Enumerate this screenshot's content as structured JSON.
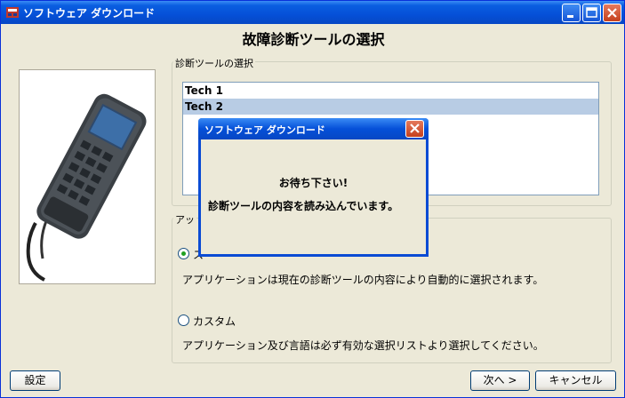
{
  "window": {
    "title": "ソフトウェア ダウンロード"
  },
  "heading": "故障診断ツールの選択",
  "tool_group": {
    "label": "診断ツールの選択",
    "items": [
      {
        "label": "Tech 1",
        "selected": false
      },
      {
        "label": "Tech 2",
        "selected": true
      }
    ]
  },
  "app_group": {
    "label_visible": "アッ",
    "option_standard": {
      "label_visible": "ス",
      "selected": true,
      "description": "アプリケーションは現在の診断ツールの内容により自動的に選択されます。"
    },
    "option_custom": {
      "label": "カスタム",
      "selected": false,
      "description": "アプリケーション及び言語は必ず有効な選択リストより選択してください。"
    }
  },
  "buttons": {
    "settings": "設定",
    "next": "次へ >",
    "cancel": "キャンセル"
  },
  "dialog": {
    "title": "ソフトウェア ダウンロード",
    "message_line1": "お待ち下さい!",
    "message_line2": "診断ツールの内容を読み込んでいます。"
  },
  "colors": {
    "titlebar": "#0550d8",
    "selection": "#b8cce4",
    "close_button": "#c5401d"
  }
}
